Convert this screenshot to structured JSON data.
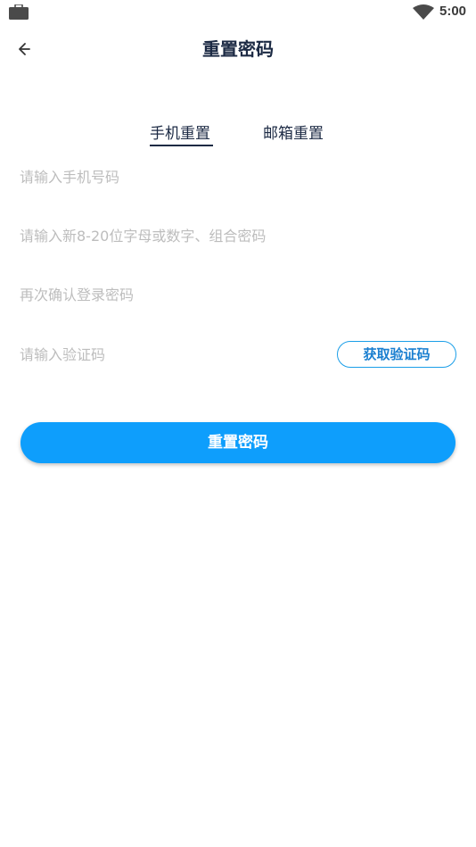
{
  "status_bar": {
    "time": "5:00",
    "left_icon": "briefcase-icon",
    "right_icon": "wifi-icon"
  },
  "header": {
    "title": "重置密码",
    "back_icon": "back-arrow-icon"
  },
  "tabs": {
    "items": [
      {
        "label": "手机重置",
        "active": true
      },
      {
        "label": "邮箱重置",
        "active": false
      }
    ]
  },
  "form": {
    "phone_placeholder": "请输入手机号码",
    "new_password_placeholder": "请输入新8-20位字母或数字、组合密码",
    "confirm_password_placeholder": "再次确认登录密码",
    "code_placeholder": "请输入验证码",
    "get_code_label": "获取验证码",
    "submit_label": "重置密码"
  },
  "colors": {
    "primary": "#0e9efc",
    "title": "#1c2a44",
    "placeholder": "#bdbdbd"
  }
}
